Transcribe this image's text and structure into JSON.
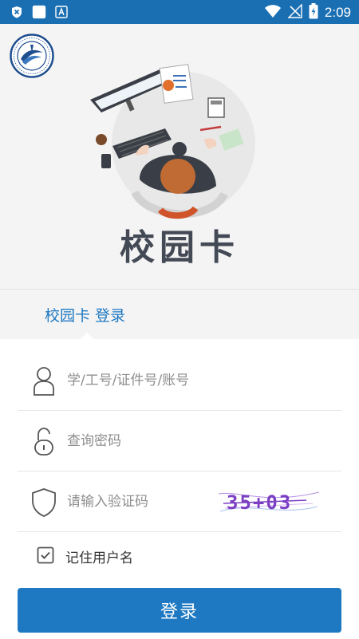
{
  "status_bar": {
    "time": "2:09",
    "left_icons": [
      "close-x-notification-icon",
      "blank-square-icon",
      "font-a-icon"
    ],
    "right_icons": [
      "wifi-icon",
      "no-signal-icon",
      "battery-charging-icon"
    ]
  },
  "hero": {
    "logo": "university-seal-logo",
    "illustration": "desk-workspace-illustration",
    "title": "校园卡"
  },
  "tab": {
    "label": "校园卡  登录"
  },
  "form": {
    "username_placeholder": "学/工号/证件号/账号",
    "password_placeholder": "查询密码",
    "captcha_placeholder": "请输入验证码",
    "captcha_text": "35+03",
    "remember_label": "记住用户名",
    "remember_checked": true,
    "login_label": "登录"
  },
  "colors": {
    "status_bar": "#1a6fb3",
    "accent": "#1f79c2",
    "hero_bg": "#f4f4f4",
    "captcha_text": "#7b3fc4"
  }
}
